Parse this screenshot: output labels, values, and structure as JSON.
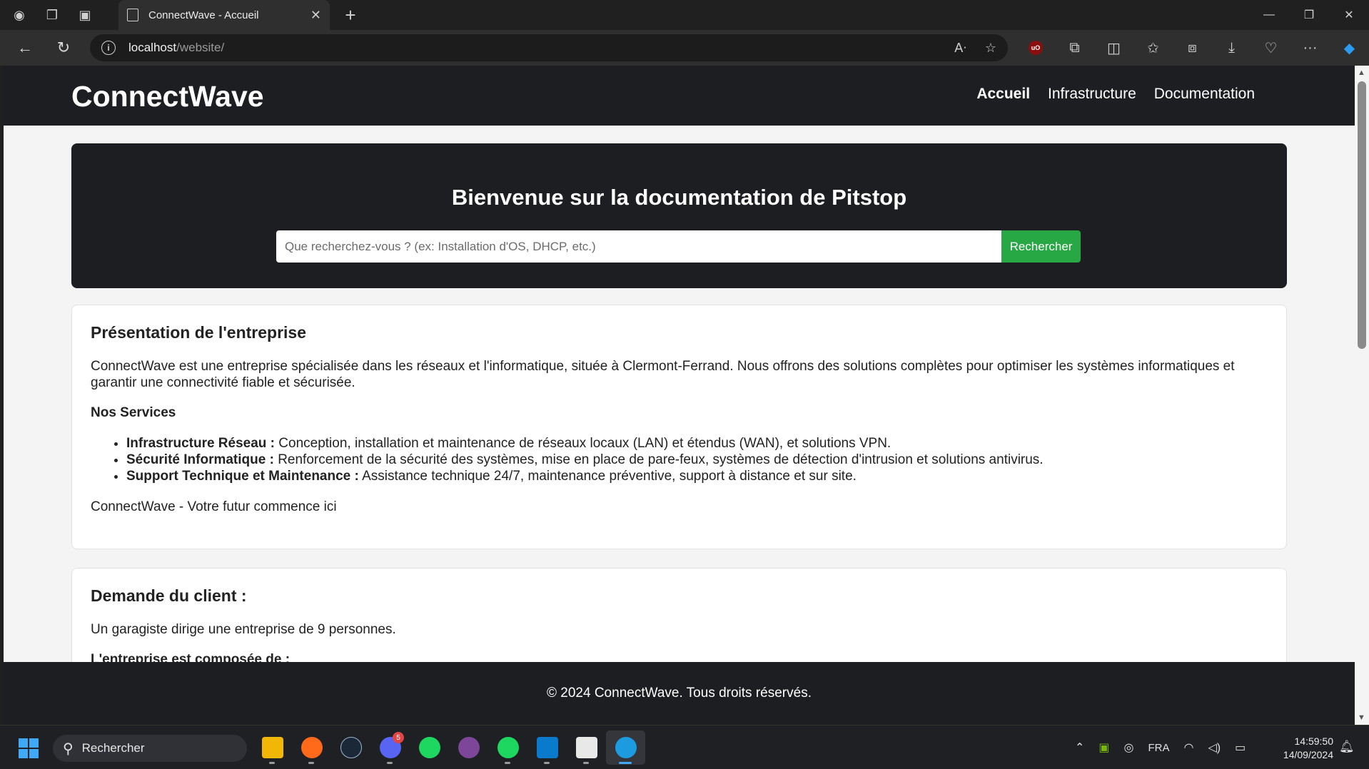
{
  "browser": {
    "tab_title": "ConnectWave - Accueil",
    "url_host": "localhost",
    "url_path": "/website/"
  },
  "site": {
    "brand": "ConnectWave",
    "nav": [
      {
        "label": "Accueil",
        "active": true
      },
      {
        "label": "Infrastructure",
        "active": false
      },
      {
        "label": "Documentation",
        "active": false
      }
    ],
    "hero": {
      "title": "Bienvenue sur la documentation de Pitstop",
      "search_placeholder": "Que recherchez-vous ? (ex: Installation d'OS, DHCP, etc.)",
      "search_button": "Rechercher"
    },
    "presentation": {
      "title": "Présentation de l'entreprise",
      "intro": "ConnectWave est une entreprise spécialisée dans les réseaux et l'informatique, située à Clermont-Ferrand. Nous offrons des solutions complètes pour optimiser les systèmes informatiques et garantir une connectivité fiable et sécurisée.",
      "services_title": "Nos Services",
      "services": [
        {
          "name": "Infrastructure Réseau :",
          "desc": " Conception, installation et maintenance de réseaux locaux (LAN) et étendus (WAN), et solutions VPN."
        },
        {
          "name": "Sécurité Informatique :",
          "desc": " Renforcement de la sécurité des systèmes, mise en place de pare-feux, systèmes de détection d'intrusion et solutions antivirus."
        },
        {
          "name": "Support Technique et Maintenance :",
          "desc": " Assistance technique 24/7, maintenance préventive, support à distance et sur site."
        }
      ],
      "tagline": "ConnectWave - Votre futur commence ici"
    },
    "client": {
      "title": "Demande du client :",
      "text": "Un garagiste dirige une entreprise de 9 personnes.",
      "subtitle": "L'entreprise est composée de :"
    },
    "footer": "© 2024 ConnectWave. Tous droits réservés."
  },
  "taskbar": {
    "search_label": "Rechercher",
    "discord_badge": "5",
    "language": "FRA",
    "time": "14:59:50",
    "date": "14/09/2024"
  },
  "colors": {
    "header_bg": "#1c1e22",
    "search_button": "#28a745",
    "page_bg": "#f4f4f4"
  }
}
